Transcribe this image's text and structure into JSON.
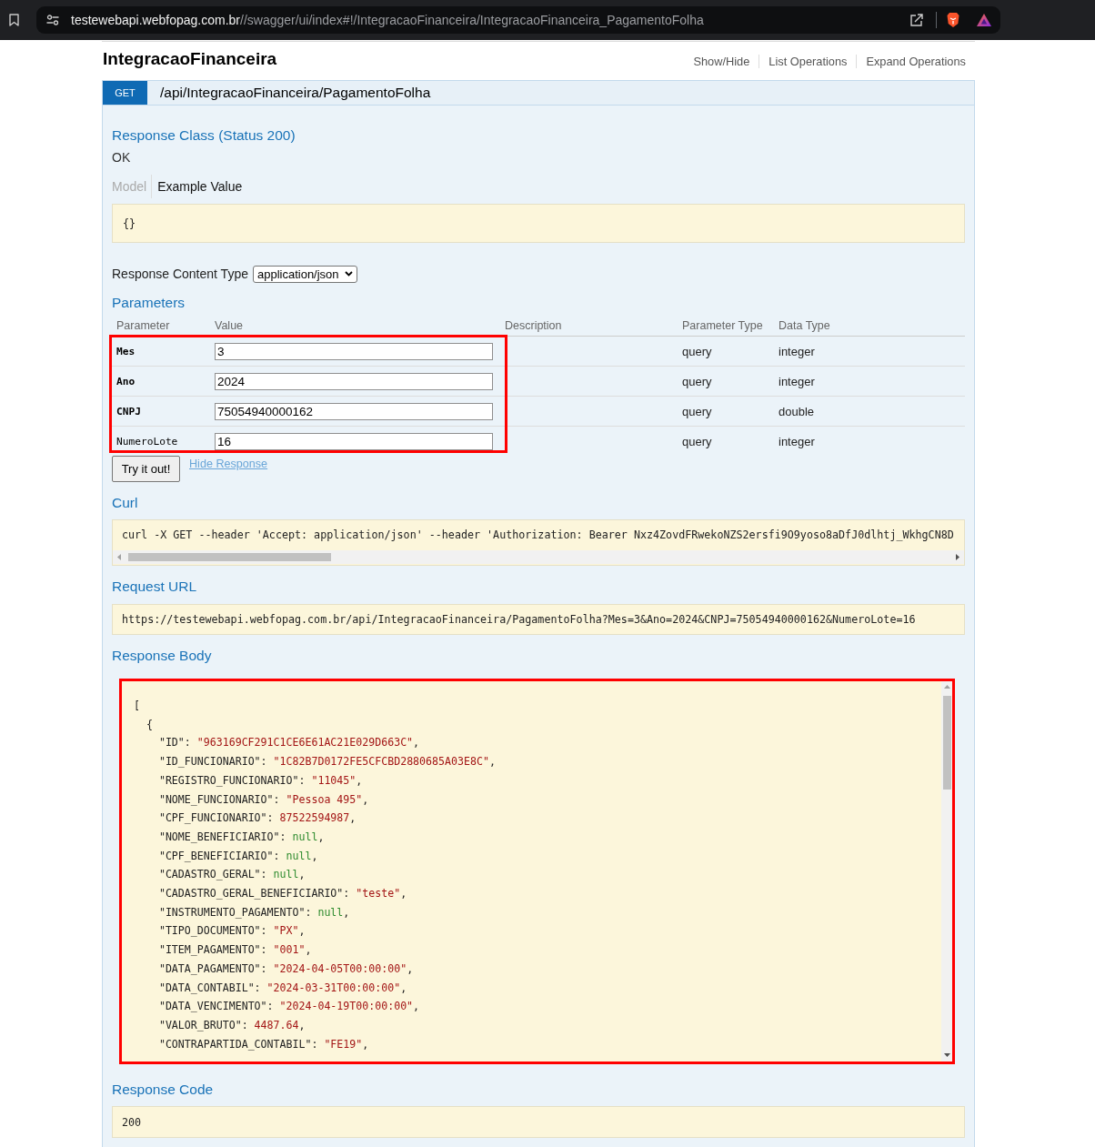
{
  "browser": {
    "url_host": "testewebapi.webfopag.com.br",
    "url_path": "//swagger/ui/index#!/IntegracaoFinanceira/IntegracaoFinanceira_PagamentoFolha"
  },
  "resource": {
    "title": "IntegracaoFinanceira",
    "actions": [
      "Show/Hide",
      "List Operations",
      "Expand Operations"
    ]
  },
  "operation": {
    "method": "GET",
    "path": "/api/IntegracaoFinanceira/PagamentoFolha"
  },
  "response_class": {
    "heading": "Response Class (Status 200)",
    "description": "OK",
    "tabs": [
      {
        "label": "Model",
        "selected": false
      },
      {
        "label": "Example Value",
        "selected": true
      }
    ],
    "example": "{}"
  },
  "response_content_type": {
    "label": "Response Content Type",
    "value": "application/json"
  },
  "parameters": {
    "heading": "Parameters",
    "highlighted": true,
    "columns": [
      "Parameter",
      "Value",
      "Description",
      "Parameter Type",
      "Data Type"
    ],
    "rows": [
      {
        "name": "Mes",
        "required": true,
        "value": "3",
        "parameter_type": "query",
        "data_type": "integer"
      },
      {
        "name": "Ano",
        "required": true,
        "value": "2024",
        "parameter_type": "query",
        "data_type": "integer"
      },
      {
        "name": "CNPJ",
        "required": true,
        "value": "75054940000162",
        "parameter_type": "query",
        "data_type": "double"
      },
      {
        "name": "NumeroLote",
        "required": false,
        "value": "16",
        "parameter_type": "query",
        "data_type": "integer"
      }
    ]
  },
  "actions": {
    "try_button": "Try it out!",
    "hide_link": "Hide Response"
  },
  "curl": {
    "heading": "Curl",
    "command": "curl -X GET --header 'Accept: application/json' --header 'Authorization: Bearer Nxz4ZovdFRwekoNZS2ersfi9O9yoso8aDfJ0dlhtj_WkhgCN8D"
  },
  "request_url": {
    "heading": "Request URL",
    "url": "https://testewebapi.webfopag.com.br/api/IntegracaoFinanceira/PagamentoFolha?Mes=3&Ano=2024&CNPJ=75054940000162&NumeroLote=16"
  },
  "response_body": {
    "heading": "Response Body",
    "highlighted": true,
    "lines": [
      {
        "text": "[",
        "children": [
          {
            "text": "{",
            "children": [
              {
                "key": "\"ID\":",
                "value": "\"963169CF291C1CE6E61AC21E029D663C\"",
                "kind": "string",
                "tail": ","
              },
              {
                "key": "\"ID_FUNCIONARIO\":",
                "value": "\"1C82B7D0172FE5CFCBD2880685A03E8C\"",
                "kind": "string",
                "tail": ","
              },
              {
                "key": "\"REGISTRO_FUNCIONARIO\":",
                "value": "\"11045\"",
                "kind": "string",
                "tail": ","
              },
              {
                "key": "\"NOME_FUNCIONARIO\":",
                "value": "\"Pessoa 495\"",
                "kind": "string",
                "tail": ","
              },
              {
                "key": "\"CPF_FUNCIONARIO\":",
                "value": "87522594987",
                "kind": "number",
                "tail": ","
              },
              {
                "key": "\"NOME_BENEFICIARIO\":",
                "value": "null",
                "kind": "null",
                "tail": ","
              },
              {
                "key": "\"CPF_BENEFICIARIO\":",
                "value": "null",
                "kind": "null",
                "tail": ","
              },
              {
                "key": "\"CADASTRO_GERAL\":",
                "value": "null",
                "kind": "null",
                "tail": ","
              },
              {
                "key": "\"CADASTRO_GERAL_BENEFICIARIO\":",
                "value": "\"teste\"",
                "kind": "string",
                "tail": ","
              },
              {
                "key": "\"INSTRUMENTO_PAGAMENTO\":",
                "value": "null",
                "kind": "null",
                "tail": ","
              },
              {
                "key": "\"TIPO_DOCUMENTO\":",
                "value": "\"PX\"",
                "kind": "string",
                "tail": ","
              },
              {
                "key": "\"ITEM_PAGAMENTO\":",
                "value": "\"001\"",
                "kind": "string",
                "tail": ","
              },
              {
                "key": "\"DATA_PAGAMENTO\":",
                "value": "\"2024-04-05T00:00:00\"",
                "kind": "string",
                "tail": ","
              },
              {
                "key": "\"DATA_CONTABIL\":",
                "value": "\"2024-03-31T00:00:00\"",
                "kind": "string",
                "tail": ","
              },
              {
                "key": "\"DATA_VENCIMENTO\":",
                "value": "\"2024-04-19T00:00:00\"",
                "kind": "string",
                "tail": ","
              },
              {
                "key": "\"VALOR_BRUTO\":",
                "value": "4487.64",
                "kind": "number",
                "tail": ","
              },
              {
                "key": "\"CONTRAPARTIDA_CONTABIL\":",
                "value": "\"FE19\"",
                "kind": "string",
                "tail": ","
              }
            ]
          }
        ]
      }
    ]
  },
  "response_code": {
    "heading": "Response Code",
    "value": "200"
  }
}
